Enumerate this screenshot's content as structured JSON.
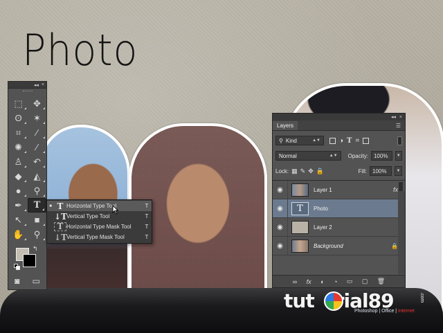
{
  "canvas": {
    "title": "Photo"
  },
  "tools_panel": {
    "titlebar": {
      "collapse": "◂◂",
      "close": "×"
    },
    "tools": [
      {
        "name": "marquee-tool-icon",
        "glyph": "⬚"
      },
      {
        "name": "move-tool-icon",
        "glyph": "✥"
      },
      {
        "name": "lasso-tool-icon",
        "glyph": "ʘ"
      },
      {
        "name": "magic-wand-tool-icon",
        "glyph": "✶"
      },
      {
        "name": "crop-tool-icon",
        "glyph": "⌗"
      },
      {
        "name": "eyedropper-tool-icon",
        "glyph": "⁄"
      },
      {
        "name": "healing-brush-tool-icon",
        "glyph": "✺"
      },
      {
        "name": "brush-tool-icon",
        "glyph": "⁄"
      },
      {
        "name": "clone-stamp-tool-icon",
        "glyph": "♙"
      },
      {
        "name": "history-brush-tool-icon",
        "glyph": "↶"
      },
      {
        "name": "eraser-tool-icon",
        "glyph": "◆"
      },
      {
        "name": "paint-bucket-tool-icon",
        "glyph": "◭"
      },
      {
        "name": "blur-tool-icon",
        "glyph": "●"
      },
      {
        "name": "dodge-tool-icon",
        "glyph": "⚲"
      },
      {
        "name": "pen-tool-icon",
        "glyph": "✒"
      },
      {
        "name": "type-tool-icon",
        "glyph": "T"
      },
      {
        "name": "path-selection-tool-icon",
        "glyph": "↖"
      },
      {
        "name": "rectangle-tool-icon",
        "glyph": "■"
      },
      {
        "name": "hand-tool-icon",
        "glyph": "✋"
      },
      {
        "name": "zoom-tool-icon",
        "glyph": "⚲"
      }
    ],
    "bottom": [
      {
        "name": "quick-mask-icon",
        "glyph": "◙"
      },
      {
        "name": "screen-mode-icon",
        "glyph": "▭"
      }
    ],
    "swap_glyph": "↰"
  },
  "type_flyout": {
    "items": [
      {
        "label": "Horizontal Type Tool",
        "icon": "T",
        "key": "T",
        "bullet": "■"
      },
      {
        "label": "Vertical Type Tool",
        "icon": "↓T",
        "key": "T",
        "bullet": ""
      },
      {
        "label": "Horizontal Type Mask Tool",
        "icon": "T",
        "key": "T",
        "bullet": ""
      },
      {
        "label": "Vertical Type Mask Tool",
        "icon": "↓T",
        "key": "T",
        "bullet": ""
      }
    ]
  },
  "layers_panel": {
    "titlebar": {
      "collapse": "◂◂",
      "close": "×"
    },
    "tab": "Layers",
    "menu_icon": "☰",
    "filter_kind": "Kind",
    "filter_search_glyph": "⚲",
    "blend_mode": "Normal",
    "opacity_label": "Opacity:",
    "opacity_value": "100%",
    "lock_label": "Lock:",
    "fill_label": "Fill:",
    "fill_value": "100%",
    "layers": [
      {
        "name": "Layer 1",
        "thumb": "photo",
        "badge": "fx",
        "italic": false
      },
      {
        "name": "Photo",
        "thumb": "text",
        "thumb_glyph": "T",
        "badge": "",
        "italic": false
      },
      {
        "name": "Layer 2",
        "thumb": "plain",
        "badge": "",
        "italic": false
      },
      {
        "name": "Background",
        "thumb": "bg",
        "badge": "🔒",
        "italic": true
      }
    ],
    "footer_icons": [
      "∞",
      "fx",
      "◐",
      "◔",
      "▭",
      "▢",
      "🗑"
    ]
  },
  "watermark": {
    "brand_prefix": "tut",
    "brand_suffix": "rial89",
    "domain_suffix": ".com",
    "tagline_a": "Photoshop | Office | ",
    "tagline_b": "Internet"
  },
  "colors": {
    "panel_bg": "#535353",
    "selected_layer": "#6b7a8e",
    "foreground_swatch": "#c4bdb2",
    "background_swatch": "#000000"
  }
}
